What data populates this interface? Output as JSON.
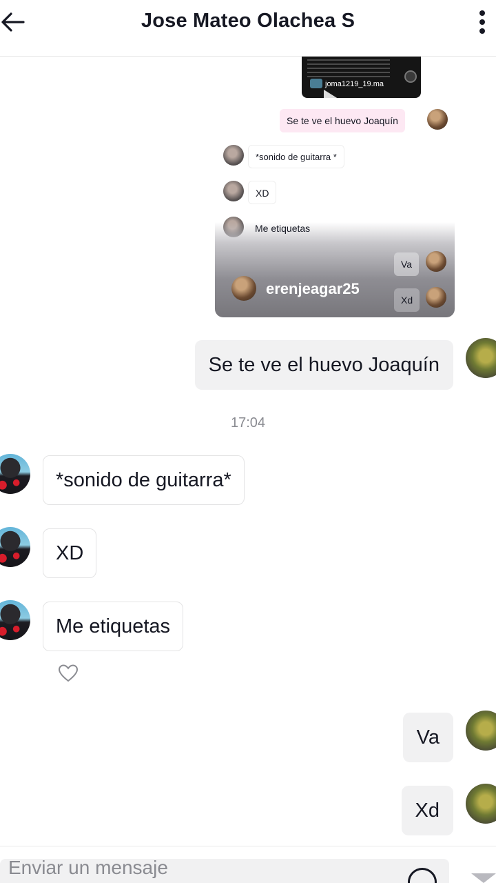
{
  "header": {
    "title": "Jose Mateo Olachea S",
    "back_icon": "arrow-left-icon",
    "more_icon": "more-vertical-icon"
  },
  "shared_screenshot": {
    "video_handle": "joma1219_19.ma",
    "messages": [
      {
        "text": "Se te ve el huevo Joaquín",
        "side": "out"
      },
      {
        "text": "*sonido de guitarra *",
        "side": "in"
      },
      {
        "text": "XD",
        "side": "in"
      },
      {
        "text": "Me etiquetas",
        "side": "in"
      },
      {
        "text": "Va",
        "side": "out"
      },
      {
        "text": "Xd",
        "side": "out"
      }
    ],
    "user_tag": "erenjeagar25"
  },
  "chat": {
    "msg1": "Se te ve el huevo Joaquín",
    "timestamp": "17:04",
    "msg2": "*sonido de guitarra*",
    "msg3": "XD",
    "msg4": "Me etiquetas",
    "msg5": "Va",
    "msg6": "Xd"
  },
  "input": {
    "placeholder": "Enviar un mensaje"
  },
  "colors": {
    "accent_pink_bubble": "#fde8f3",
    "out_bubble": "#f1f1f2",
    "text": "#161823",
    "muted": "#8a8b91"
  }
}
